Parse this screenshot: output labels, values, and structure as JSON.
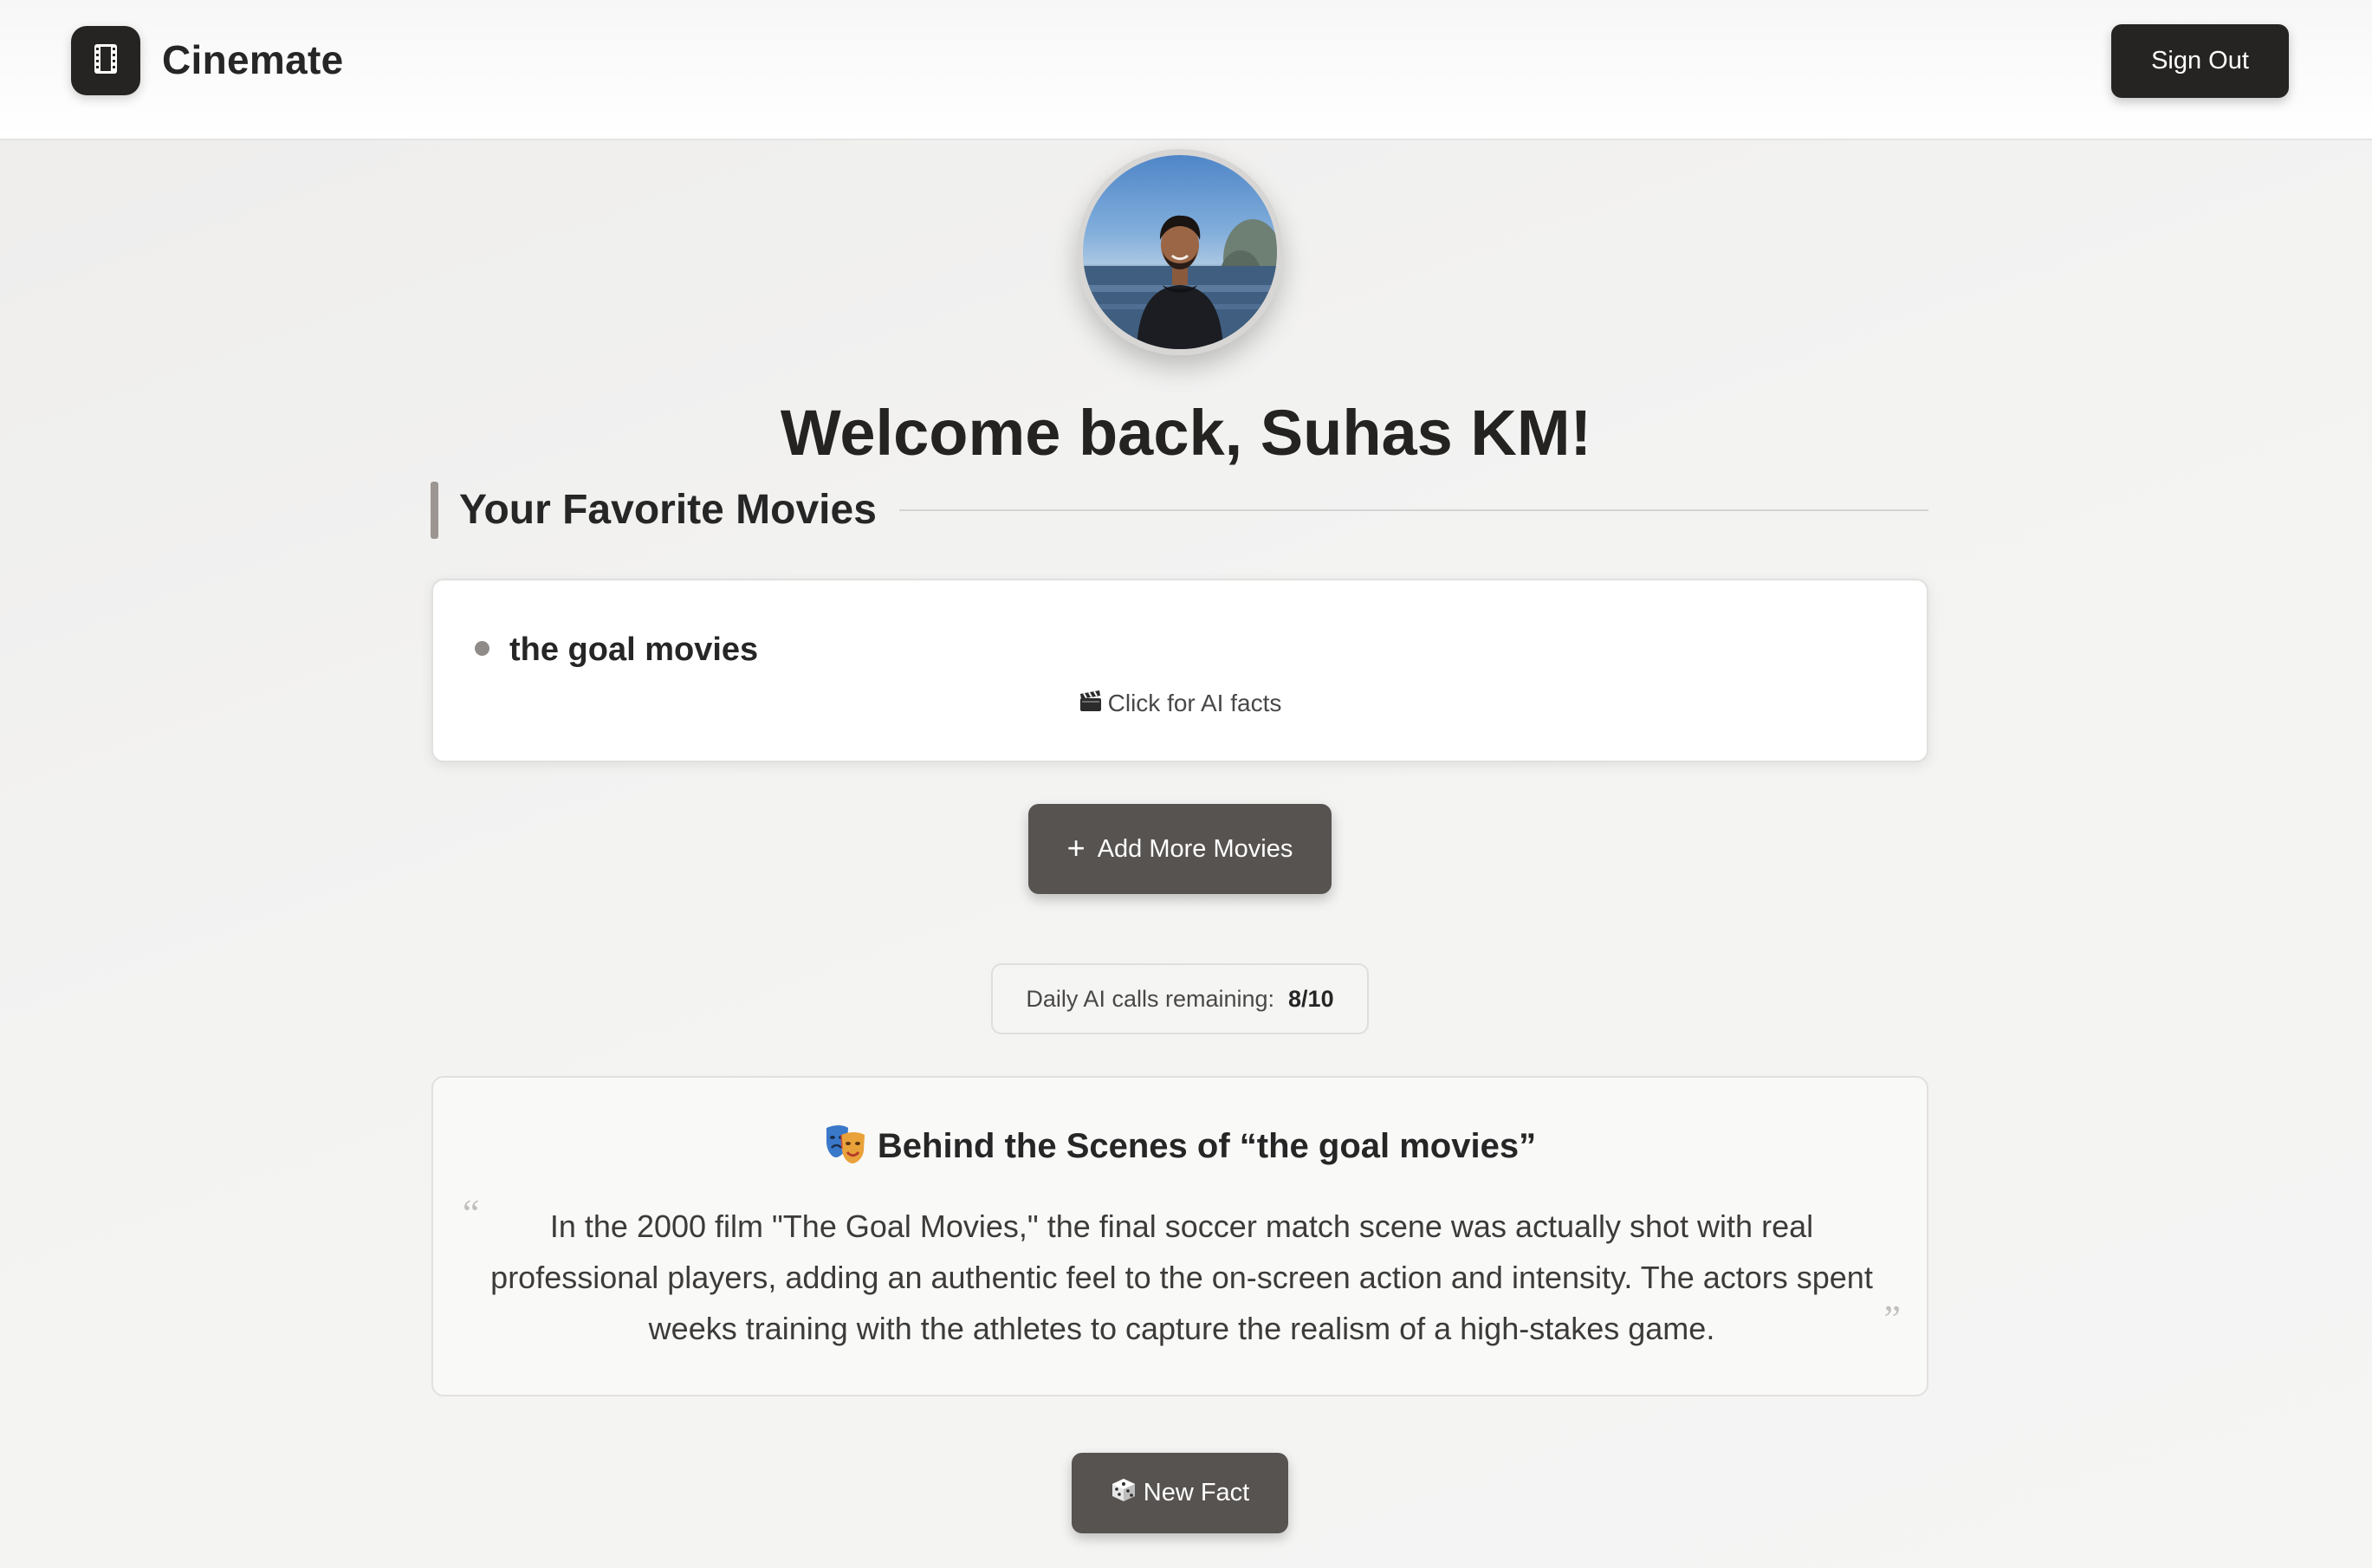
{
  "header": {
    "app_title": "Cinemate",
    "logo_icon": "film-icon",
    "sign_out_label": "Sign Out"
  },
  "profile": {
    "avatar_alt": "Profile photo",
    "welcome_text": "Welcome back, Suhas KM!"
  },
  "favorites": {
    "section_title": "Your Favorite Movies",
    "movies": [
      {
        "title": "the goal movies",
        "hint": "Click for AI facts",
        "hint_icon": "clapperboard-icon"
      }
    ],
    "add_button_label": "Add More Movies",
    "add_button_icon": "plus-icon"
  },
  "quota": {
    "label": "Daily AI calls remaining:",
    "value": "8/10"
  },
  "fact": {
    "title": "Behind the Scenes of “the goal movies”",
    "title_icon": "theater-masks-icon",
    "text": "In the 2000 film \"The Goal Movies,\" the final soccer match scene was actually shot with real professional players, adding an authentic feel to the on-screen action and intensity. The actors spent weeks training with the athletes to capture the realism of a high-stakes game.",
    "quote_open": "“",
    "quote_close": "”",
    "new_fact_label": "New Fact",
    "new_fact_icon": "dice-icon"
  },
  "colors": {
    "primary_dark": "#262422",
    "button_secondary": "#575350",
    "accent_bar": "#9c9693",
    "background": "#f3f3f2"
  }
}
